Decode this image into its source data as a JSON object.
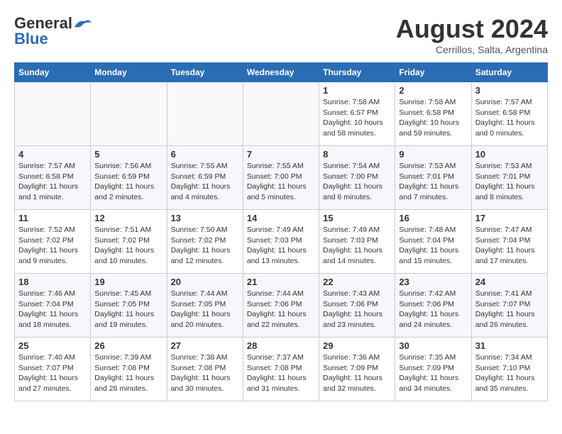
{
  "header": {
    "logo": {
      "general": "General",
      "blue": "Blue"
    },
    "title": "August 2024",
    "subtitle": "Cerrillos, Salta, Argentina"
  },
  "calendar": {
    "days_of_week": [
      "Sunday",
      "Monday",
      "Tuesday",
      "Wednesday",
      "Thursday",
      "Friday",
      "Saturday"
    ],
    "weeks": [
      [
        {
          "day": "",
          "info": ""
        },
        {
          "day": "",
          "info": ""
        },
        {
          "day": "",
          "info": ""
        },
        {
          "day": "",
          "info": ""
        },
        {
          "day": "1",
          "info": "Sunrise: 7:58 AM\nSunset: 6:57 PM\nDaylight: 10 hours and 58 minutes."
        },
        {
          "day": "2",
          "info": "Sunrise: 7:58 AM\nSunset: 6:58 PM\nDaylight: 10 hours and 59 minutes."
        },
        {
          "day": "3",
          "info": "Sunrise: 7:57 AM\nSunset: 6:58 PM\nDaylight: 11 hours and 0 minutes."
        }
      ],
      [
        {
          "day": "4",
          "info": "Sunrise: 7:57 AM\nSunset: 6:58 PM\nDaylight: 11 hours and 1 minute."
        },
        {
          "day": "5",
          "info": "Sunrise: 7:56 AM\nSunset: 6:59 PM\nDaylight: 11 hours and 2 minutes."
        },
        {
          "day": "6",
          "info": "Sunrise: 7:55 AM\nSunset: 6:59 PM\nDaylight: 11 hours and 4 minutes."
        },
        {
          "day": "7",
          "info": "Sunrise: 7:55 AM\nSunset: 7:00 PM\nDaylight: 11 hours and 5 minutes."
        },
        {
          "day": "8",
          "info": "Sunrise: 7:54 AM\nSunset: 7:00 PM\nDaylight: 11 hours and 6 minutes."
        },
        {
          "day": "9",
          "info": "Sunrise: 7:53 AM\nSunset: 7:01 PM\nDaylight: 11 hours and 7 minutes."
        },
        {
          "day": "10",
          "info": "Sunrise: 7:53 AM\nSunset: 7:01 PM\nDaylight: 11 hours and 8 minutes."
        }
      ],
      [
        {
          "day": "11",
          "info": "Sunrise: 7:52 AM\nSunset: 7:02 PM\nDaylight: 11 hours and 9 minutes."
        },
        {
          "day": "12",
          "info": "Sunrise: 7:51 AM\nSunset: 7:02 PM\nDaylight: 11 hours and 10 minutes."
        },
        {
          "day": "13",
          "info": "Sunrise: 7:50 AM\nSunset: 7:02 PM\nDaylight: 11 hours and 12 minutes."
        },
        {
          "day": "14",
          "info": "Sunrise: 7:49 AM\nSunset: 7:03 PM\nDaylight: 11 hours and 13 minutes."
        },
        {
          "day": "15",
          "info": "Sunrise: 7:49 AM\nSunset: 7:03 PM\nDaylight: 11 hours and 14 minutes."
        },
        {
          "day": "16",
          "info": "Sunrise: 7:48 AM\nSunset: 7:04 PM\nDaylight: 11 hours and 15 minutes."
        },
        {
          "day": "17",
          "info": "Sunrise: 7:47 AM\nSunset: 7:04 PM\nDaylight: 11 hours and 17 minutes."
        }
      ],
      [
        {
          "day": "18",
          "info": "Sunrise: 7:46 AM\nSunset: 7:04 PM\nDaylight: 11 hours and 18 minutes."
        },
        {
          "day": "19",
          "info": "Sunrise: 7:45 AM\nSunset: 7:05 PM\nDaylight: 11 hours and 19 minutes."
        },
        {
          "day": "20",
          "info": "Sunrise: 7:44 AM\nSunset: 7:05 PM\nDaylight: 11 hours and 20 minutes."
        },
        {
          "day": "21",
          "info": "Sunrise: 7:44 AM\nSunset: 7:06 PM\nDaylight: 11 hours and 22 minutes."
        },
        {
          "day": "22",
          "info": "Sunrise: 7:43 AM\nSunset: 7:06 PM\nDaylight: 11 hours and 23 minutes."
        },
        {
          "day": "23",
          "info": "Sunrise: 7:42 AM\nSunset: 7:06 PM\nDaylight: 11 hours and 24 minutes."
        },
        {
          "day": "24",
          "info": "Sunrise: 7:41 AM\nSunset: 7:07 PM\nDaylight: 11 hours and 26 minutes."
        }
      ],
      [
        {
          "day": "25",
          "info": "Sunrise: 7:40 AM\nSunset: 7:07 PM\nDaylight: 11 hours and 27 minutes."
        },
        {
          "day": "26",
          "info": "Sunrise: 7:39 AM\nSunset: 7:08 PM\nDaylight: 11 hours and 28 minutes."
        },
        {
          "day": "27",
          "info": "Sunrise: 7:38 AM\nSunset: 7:08 PM\nDaylight: 11 hours and 30 minutes."
        },
        {
          "day": "28",
          "info": "Sunrise: 7:37 AM\nSunset: 7:08 PM\nDaylight: 11 hours and 31 minutes."
        },
        {
          "day": "29",
          "info": "Sunrise: 7:36 AM\nSunset: 7:09 PM\nDaylight: 11 hours and 32 minutes."
        },
        {
          "day": "30",
          "info": "Sunrise: 7:35 AM\nSunset: 7:09 PM\nDaylight: 11 hours and 34 minutes."
        },
        {
          "day": "31",
          "info": "Sunrise: 7:34 AM\nSunset: 7:10 PM\nDaylight: 11 hours and 35 minutes."
        }
      ]
    ]
  }
}
